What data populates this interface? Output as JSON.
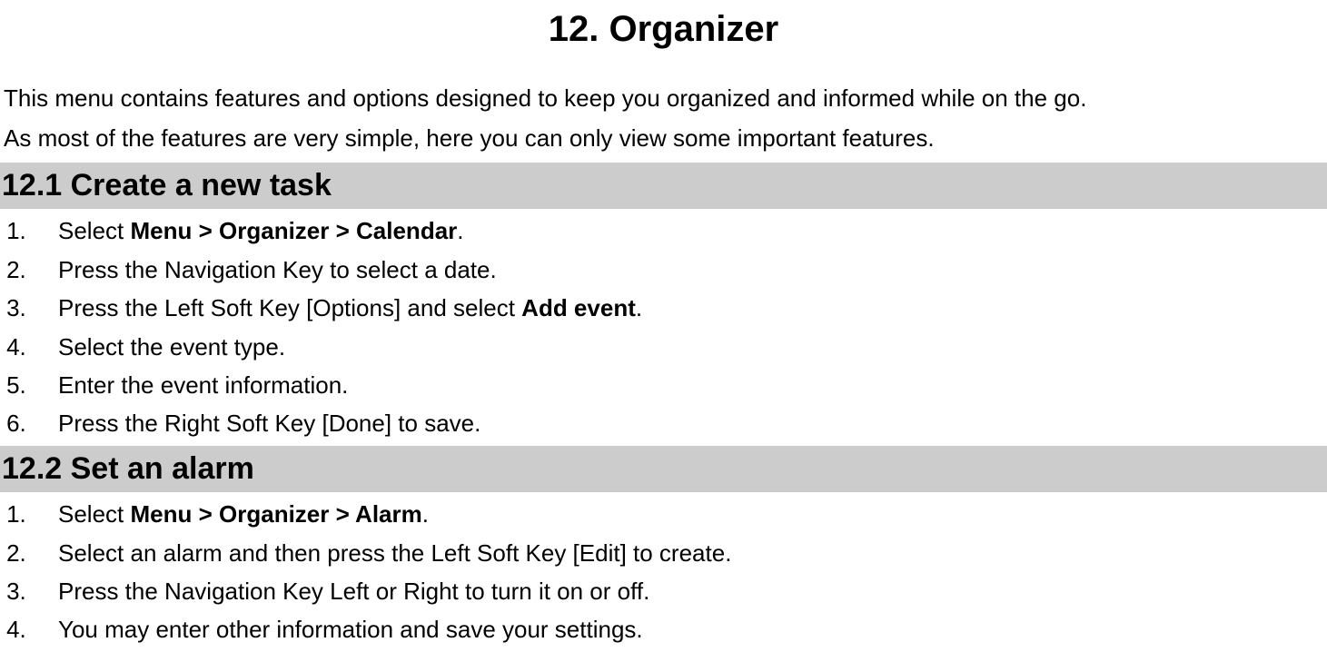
{
  "page": {
    "title": "12. Organizer",
    "intro": [
      "This menu contains features and options designed to keep you organized and informed while on the go.",
      "As most of the features are very simple, here you can only view some important features."
    ]
  },
  "sections": [
    {
      "heading": "12.1  Create a new task",
      "steps": [
        [
          {
            "text": "Select ",
            "bold": false
          },
          {
            "text": "Menu > Organizer > Calendar",
            "bold": true
          },
          {
            "text": ".",
            "bold": false
          }
        ],
        [
          {
            "text": "Press the Navigation Key to select a date.",
            "bold": false
          }
        ],
        [
          {
            "text": "Press the Left Soft Key [Options] and select ",
            "bold": false
          },
          {
            "text": "Add event",
            "bold": true
          },
          {
            "text": ".",
            "bold": false
          }
        ],
        [
          {
            "text": "Select the event type.",
            "bold": false
          }
        ],
        [
          {
            "text": "Enter the event information.",
            "bold": false
          }
        ],
        [
          {
            "text": "Press the Right Soft Key [Done] to save.",
            "bold": false
          }
        ]
      ]
    },
    {
      "heading": "12.2  Set an alarm",
      "steps": [
        [
          {
            "text": "Select ",
            "bold": false
          },
          {
            "text": "Menu > Organizer > Alarm",
            "bold": true
          },
          {
            "text": ".",
            "bold": false
          }
        ],
        [
          {
            "text": "Select an alarm and then press the Left Soft Key [Edit] to create.",
            "bold": false
          }
        ],
        [
          {
            "text": "Press the Navigation Key Left or Right to turn it on or off.",
            "bold": false
          }
        ],
        [
          {
            "text": "You may enter other information and save your settings.",
            "bold": false
          }
        ]
      ]
    }
  ]
}
